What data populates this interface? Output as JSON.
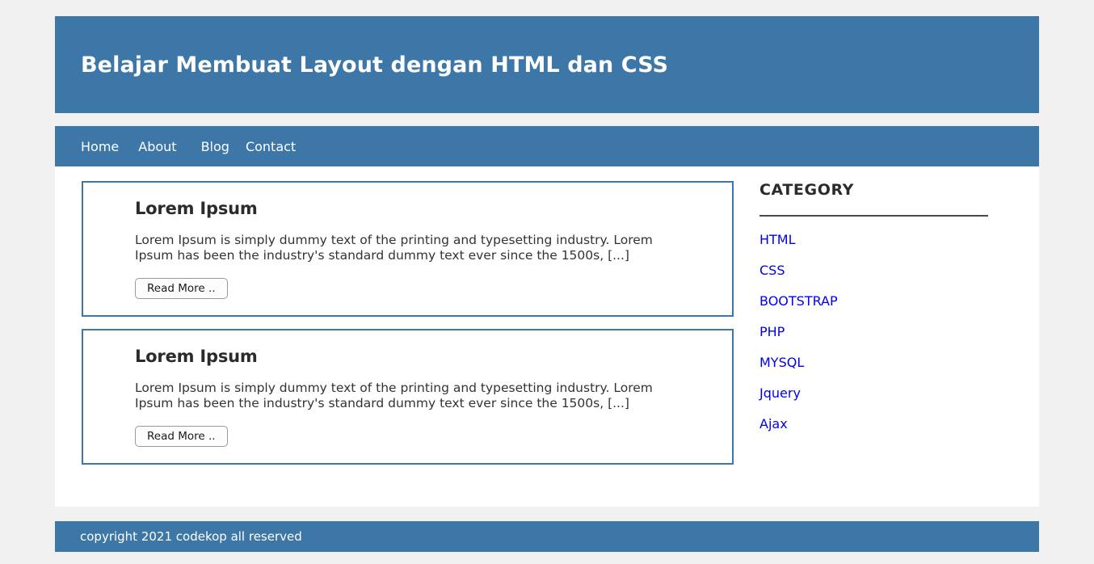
{
  "header": {
    "title": "Belajar Membuat Layout dengan HTML dan CSS"
  },
  "nav": {
    "items": [
      {
        "label": "Home"
      },
      {
        "label": "About"
      },
      {
        "label": "Blog"
      },
      {
        "label": "Contact"
      }
    ]
  },
  "main": {
    "articles": [
      {
        "title": "Lorem Ipsum",
        "body": "Lorem Ipsum is simply dummy text of the printing and typesetting industry. Lorem Ipsum has been the industry's standard dummy text ever since the 1500s, [...]",
        "button_label": "Read More .."
      },
      {
        "title": "Lorem Ipsum",
        "body": "Lorem Ipsum is simply dummy text of the printing and typesetting industry. Lorem Ipsum has been the industry's standard dummy text ever since the 1500s, [...]",
        "button_label": "Read More .."
      }
    ]
  },
  "sidebar": {
    "title": "CATEGORY",
    "categories": [
      {
        "label": "HTML"
      },
      {
        "label": "CSS"
      },
      {
        "label": "BOOTSTRAP"
      },
      {
        "label": "PHP"
      },
      {
        "label": "MYSQL"
      },
      {
        "label": "Jquery"
      },
      {
        "label": "Ajax"
      }
    ]
  },
  "footer": {
    "copyright": "copyright 2021 codekop all reserved"
  },
  "colors": {
    "brand_blue": "#3d77a8",
    "page_background": "#f1f1f1",
    "link_blue": "#0000ee",
    "rule_gray": "#4a4a4a"
  }
}
